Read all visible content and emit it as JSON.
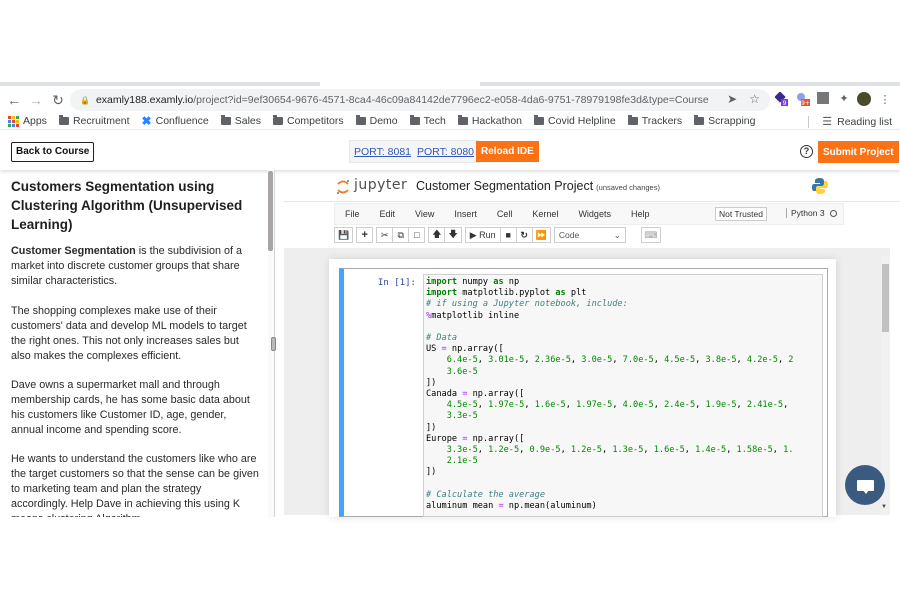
{
  "browser": {
    "url_host": "examly188.examly.io",
    "url_path": "/project?id=9ef30654-9676-4571-8ca4-46c09a84142de7796ec2-e058-4da6-9751-78979198fe3d&type=Course",
    "extension_badges": [
      "9",
      "9+"
    ],
    "bookmarks": [
      {
        "label": "Apps",
        "icon": "apps-grid-icon"
      },
      {
        "label": "Recruitment",
        "icon": "folder-icon"
      },
      {
        "label": "Confluence",
        "icon": "confluence-icon"
      },
      {
        "label": "Sales",
        "icon": "folder-icon"
      },
      {
        "label": "Competitors",
        "icon": "folder-icon"
      },
      {
        "label": "Demo",
        "icon": "folder-icon"
      },
      {
        "label": "Tech",
        "icon": "folder-icon"
      },
      {
        "label": "Hackathon",
        "icon": "folder-icon"
      },
      {
        "label": "Covid Helpline",
        "icon": "folder-icon"
      },
      {
        "label": "Trackers",
        "icon": "folder-icon"
      },
      {
        "label": "Scrapping",
        "icon": "folder-icon"
      }
    ],
    "reading_list": "Reading list"
  },
  "header": {
    "back_label": "Back to Course",
    "ports": [
      "PORT: 8081",
      "PORT: 8080"
    ],
    "reload_label": "Reload IDE",
    "help_icon": "?",
    "submit_label": "Submit Project",
    "accent": "#f97316"
  },
  "description": {
    "title": "Customers Segmentation using Clustering Algorithm (Unsupervised Learning)",
    "p1_bold": "Customer Segmentation",
    "p1_rest": " is the subdivision of a market into discrete customer groups that share similar characteristics.",
    "p2": "The shopping complexes make use of their customers' data and develop ML models to target the right ones. This not only increases sales but also makes the complexes efficient.",
    "p3": "Dave owns a supermarket mall and through membership cards, he has some basic data about his customers like Customer ID, age, gender, annual income and spending score.",
    "p4": "He wants to understand the customers like who are the target customers so that the sense can be given to marketing team and plan the strategy accordingly. Help Dave in achieving this using K means clustering Algorithm."
  },
  "jupyter": {
    "logo_text": "jupyter",
    "notebook_title": "Customer Segmentation Project",
    "save_status": "(unsaved changes)",
    "menu": [
      "File",
      "Edit",
      "View",
      "Insert",
      "Cell",
      "Kernel",
      "Widgets",
      "Help"
    ],
    "trust": "Not Trusted",
    "kernel": "Python 3",
    "run_label": "Run",
    "cell_type": "Code",
    "cell_prompt": "In [1]:"
  }
}
